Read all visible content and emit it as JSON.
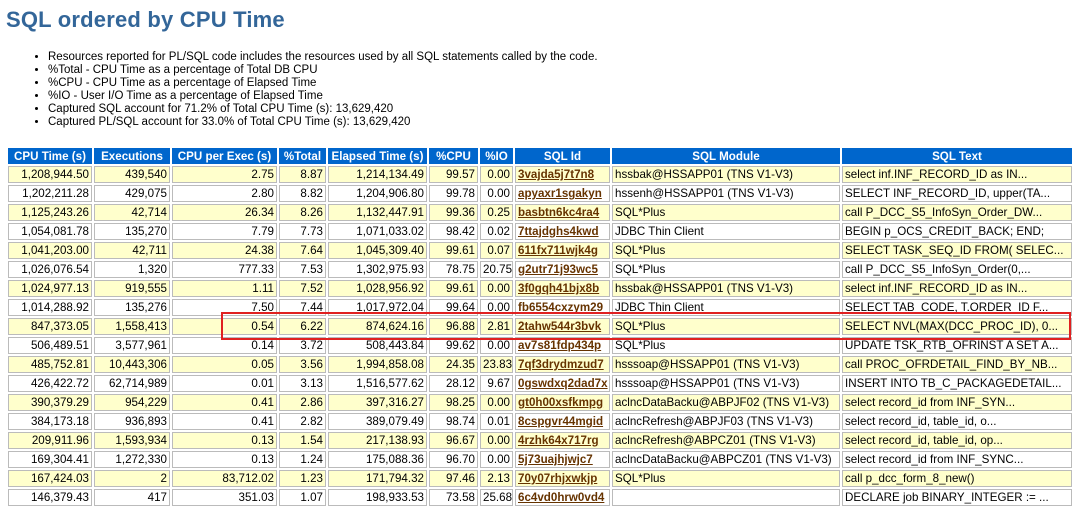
{
  "page": {
    "title": "SQL ordered by CPU Time"
  },
  "notes": [
    "Resources reported for PL/SQL code includes the resources used by all SQL statements called by the code.",
    "%Total - CPU Time as a percentage of Total DB CPU",
    "%CPU - CPU Time as a percentage of Elapsed Time",
    "%IO - User I/O Time as a percentage of Elapsed Time",
    "Captured SQL account for 71.2% of Total CPU Time (s): 13,629,420",
    "Captured PL/SQL account for 33.0% of Total CPU Time (s): 13,629,420"
  ],
  "table": {
    "headers": [
      "CPU Time (s)",
      "Executions",
      "CPU per Exec (s)",
      "%Total",
      "Elapsed Time (s)",
      "%CPU",
      "%IO",
      "SQL Id",
      "SQL Module",
      "SQL Text"
    ],
    "rows": [
      [
        "1,208,944.50",
        "439,540",
        "2.75",
        "8.87",
        "1,214,134.49",
        "99.57",
        "0.00",
        "3vajda5j7t7n8",
        "hssbak@HSSAPP01 (TNS V1-V3)",
        "select inf.INF_RECORD_ID as IN..."
      ],
      [
        "1,202,211.28",
        "429,075",
        "2.80",
        "8.82",
        "1,204,906.80",
        "99.78",
        "0.00",
        "apyaxr1sgakyn",
        "hssenh@HSSAPP01 (TNS V1-V3)",
        "SELECT INF_RECORD_ID, upper(TA..."
      ],
      [
        "1,125,243.26",
        "42,714",
        "26.34",
        "8.26",
        "1,132,447.91",
        "99.36",
        "0.25",
        "basbtn6kc4ra4",
        "SQL*Plus",
        "call P_DCC_S5_InfoSyn_Order_DW..."
      ],
      [
        "1,054,081.78",
        "135,270",
        "7.79",
        "7.73",
        "1,071,033.02",
        "98.42",
        "0.02",
        "7ttajdghs4kwd",
        "JDBC Thin Client",
        "BEGIN p_OCS_CREDIT_BACK; END;"
      ],
      [
        "1,041,203.00",
        "42,711",
        "24.38",
        "7.64",
        "1,045,309.40",
        "99.61",
        "0.07",
        "611fx711wjk4g",
        "SQL*Plus",
        "SELECT TASK_SEQ_ID FROM( SELEC..."
      ],
      [
        "1,026,076.54",
        "1,320",
        "777.33",
        "7.53",
        "1,302,975.93",
        "78.75",
        "20.75",
        "g2utr71j93wc5",
        "SQL*Plus",
        "call P_DCC_S5_InfoSyn_Order(0,..."
      ],
      [
        "1,024,977.13",
        "919,555",
        "1.11",
        "7.52",
        "1,028,956.92",
        "99.61",
        "0.00",
        "3f0gqh41bjx8b",
        "hssbak@HSSAPP01 (TNS V1-V3)",
        "select inf.INF_RECORD_ID as IN..."
      ],
      [
        "1,014,288.92",
        "135,276",
        "7.50",
        "7.44",
        "1,017,972.04",
        "99.64",
        "0.00",
        "fb6554cxzym29",
        "JDBC Thin Client",
        "SELECT TAB_CODE, T.ORDER_ID F..."
      ],
      [
        "847,373.05",
        "1,558,413",
        "0.54",
        "6.22",
        "874,624.16",
        "96.88",
        "2.81",
        "2tahw544r3bvk",
        "SQL*Plus",
        "SELECT NVL(MAX(DCC_PROC_ID), 0..."
      ],
      [
        "506,489.51",
        "3,577,961",
        "0.14",
        "3.72",
        "508,443.84",
        "99.62",
        "0.00",
        "av7s81fdp434p",
        "SQL*Plus",
        "UPDATE TSK_RTB_OFRINST A SET A..."
      ],
      [
        "485,752.81",
        "10,443,306",
        "0.05",
        "3.56",
        "1,994,858.08",
        "24.35",
        "23.83",
        "7qf3drydmzud7",
        "hsssoap@HSSAPP01 (TNS V1-V3)",
        "call PROC_OFRDETAIL_FIND_BY_NB..."
      ],
      [
        "426,422.72",
        "62,714,989",
        "0.01",
        "3.13",
        "1,516,577.62",
        "28.12",
        "9.67",
        "0gswdxq2dad7x",
        "hsssoap@HSSAPP01 (TNS V1-V3)",
        "INSERT INTO TB_C_PACKAGEDETAIL..."
      ],
      [
        "390,379.29",
        "954,229",
        "0.41",
        "2.86",
        "397,316.27",
        "98.25",
        "0.00",
        "gt0h00xsfkmpg",
        "aclncDataBacku@ABPJF02 (TNS V1-V3)",
        "select record_id from INF_SYN..."
      ],
      [
        "384,173.18",
        "936,893",
        "0.41",
        "2.82",
        "389,079.49",
        "98.74",
        "0.01",
        "8cspgvr44mgid",
        "aclncRefresh@ABPJF03 (TNS V1-V3)",
        "select record_id, table_id, o..."
      ],
      [
        "209,911.96",
        "1,593,934",
        "0.13",
        "1.54",
        "217,138.93",
        "96.67",
        "0.00",
        "4rzhk64x717rg",
        "aclncRefresh@ABPCZ01 (TNS V1-V3)",
        "select record_id, table_id, op..."
      ],
      [
        "169,304.41",
        "1,272,330",
        "0.13",
        "1.24",
        "175,088.36",
        "96.70",
        "0.00",
        "5j73uajhjwjc7",
        "aclncDataBacku@ABPCZ01 (TNS V1-V3)",
        "select record_id from INF_SYNC..."
      ],
      [
        "167,424.03",
        "2",
        "83,712.02",
        "1.23",
        "171,794.32",
        "97.46",
        "2.13",
        "70y07rhjxwkjp",
        "SQL*Plus",
        "call p_dcc_form_8_new()"
      ],
      [
        "146,379.43",
        "417",
        "351.03",
        "1.07",
        "198,933.53",
        "73.58",
        "25.68",
        "6c4vd0hrw0vd4",
        "",
        "DECLARE job BINARY_INTEGER := ..."
      ]
    ]
  },
  "colors": {
    "title": "#336699",
    "header_bg": "#0066cc",
    "odd_row_bg": "#ffffcc",
    "sql_id_link": "#663300",
    "highlight_box": "#e02020"
  }
}
